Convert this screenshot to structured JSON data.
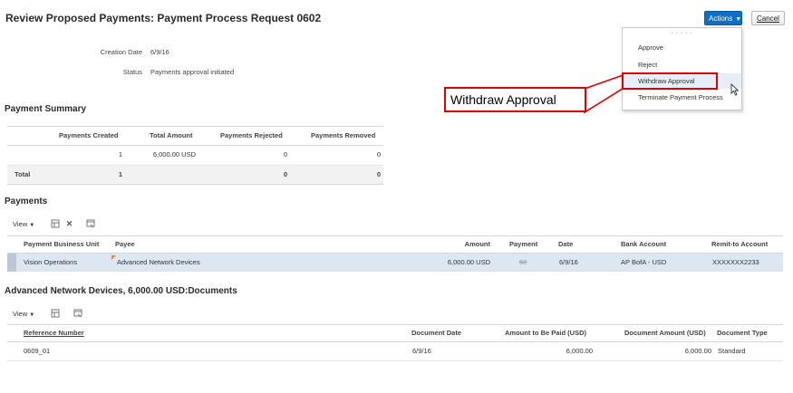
{
  "page": {
    "title": "Review Proposed Payments: Payment Process Request 0602"
  },
  "header_buttons": {
    "actions_label": "Actions",
    "cancel_label": "Cancel"
  },
  "actions_menu": {
    "items": [
      {
        "label": "Approve"
      },
      {
        "label": "Reject"
      },
      {
        "label": "Withdraw Approval"
      },
      {
        "label": "Terminate Payment Process"
      }
    ]
  },
  "callout": {
    "text": "Withdraw Approval"
  },
  "info": {
    "creation_date_label": "Creation Date",
    "creation_date_value": "6/9/16",
    "status_label": "Status",
    "status_value": "Payments approval initiated"
  },
  "payment_summary": {
    "title": "Payment Summary",
    "columns": [
      "Payments Created",
      "Total Amount",
      "Payments Rejected",
      "Payments Removed"
    ],
    "row": [
      "1",
      "6,000.00 USD",
      "0",
      "0"
    ],
    "total_label": "Total",
    "total_row": [
      "1",
      "",
      "0",
      "0"
    ]
  },
  "payments": {
    "title": "Payments",
    "view_label": "View",
    "columns": [
      "Payment Business Unit",
      "Payee",
      "Amount",
      "Payment",
      "Date",
      "Bank Account",
      "Remit-to Account"
    ],
    "rows": [
      [
        "Vision Operations",
        "Advanced Network Devices",
        "6,000.00 USD",
        "60",
        "6/9/16",
        "AP BofA - USD",
        "XXXXXXX2233"
      ]
    ]
  },
  "documents": {
    "title": "Advanced Network Devices, 6,000.00 USD:Documents",
    "view_label": "View",
    "columns": [
      "Reference Number",
      "Document Date",
      "Amount to Be Paid (USD)",
      "Document Amount (USD)",
      "Document Type"
    ],
    "rows": [
      [
        "0609_01",
        "6/9/16",
        "6,000.00",
        "6,000.00",
        "Standard"
      ]
    ]
  },
  "colors": {
    "accent": "#0f6fc6",
    "callout": "#e00000",
    "selected_row": "#dce7f2"
  },
  "icons": [
    "chevron-down-icon",
    "freeze-icon",
    "delete-icon",
    "detach-icon",
    "cursor-icon",
    "edit-flag-icon"
  ]
}
